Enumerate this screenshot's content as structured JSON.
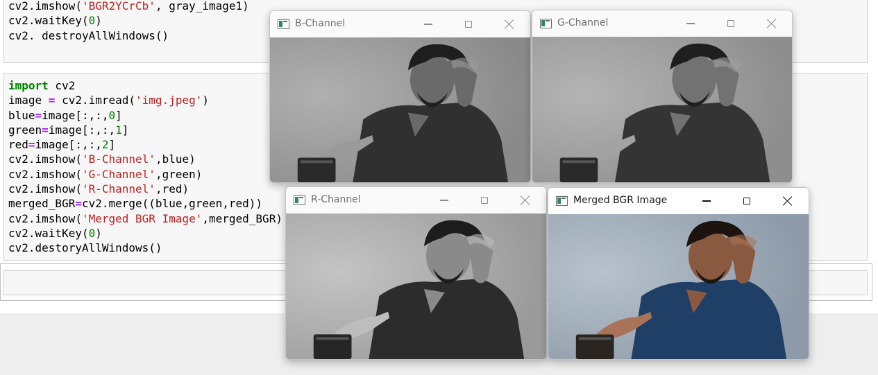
{
  "notebook": {
    "top_cell_lines": [
      {
        "parts": [
          {
            "t": "cv2.imshow(",
            "c": ""
          },
          {
            "t": "'BGR2YCrCb'",
            "c": "str"
          },
          {
            "t": ", gray_image1)",
            "c": ""
          }
        ]
      },
      {
        "parts": [
          {
            "t": "cv2.waitKey(",
            "c": ""
          },
          {
            "t": "0",
            "c": "num"
          },
          {
            "t": ")",
            "c": ""
          }
        ]
      },
      {
        "parts": [
          {
            "t": "cv2. destroyAllWindows()",
            "c": ""
          }
        ]
      }
    ],
    "main_cell_lines": [
      {
        "parts": [
          {
            "t": "import",
            "c": "kw"
          },
          {
            "t": " cv2",
            "c": ""
          }
        ]
      },
      {
        "parts": [
          {
            "t": "image ",
            "c": ""
          },
          {
            "t": "=",
            "c": "op"
          },
          {
            "t": " cv2.imread(",
            "c": ""
          },
          {
            "t": "'img.jpeg'",
            "c": "str"
          },
          {
            "t": ")",
            "c": ""
          }
        ]
      },
      {
        "parts": [
          {
            "t": "blue",
            "c": ""
          },
          {
            "t": "=",
            "c": "op"
          },
          {
            "t": "image[:,:,",
            "c": ""
          },
          {
            "t": "0",
            "c": "num"
          },
          {
            "t": "]",
            "c": ""
          }
        ]
      },
      {
        "parts": [
          {
            "t": "green",
            "c": ""
          },
          {
            "t": "=",
            "c": "op"
          },
          {
            "t": "image[:,:,",
            "c": ""
          },
          {
            "t": "1",
            "c": "num"
          },
          {
            "t": "]",
            "c": ""
          }
        ]
      },
      {
        "parts": [
          {
            "t": "red",
            "c": ""
          },
          {
            "t": "=",
            "c": "op"
          },
          {
            "t": "image[:,:,",
            "c": ""
          },
          {
            "t": "2",
            "c": "num"
          },
          {
            "t": "]",
            "c": ""
          }
        ]
      },
      {
        "parts": [
          {
            "t": "cv2.imshow(",
            "c": ""
          },
          {
            "t": "'B-Channel'",
            "c": "str"
          },
          {
            "t": ",blue)",
            "c": ""
          }
        ]
      },
      {
        "parts": [
          {
            "t": "cv2.imshow(",
            "c": ""
          },
          {
            "t": "'G-Channel'",
            "c": "str"
          },
          {
            "t": ",green)",
            "c": ""
          }
        ]
      },
      {
        "parts": [
          {
            "t": "cv2.imshow(",
            "c": ""
          },
          {
            "t": "'R-Channel'",
            "c": "str"
          },
          {
            "t": ",red)",
            "c": ""
          }
        ]
      },
      {
        "parts": [
          {
            "t": "merged_BGR",
            "c": ""
          },
          {
            "t": "=",
            "c": "op"
          },
          {
            "t": "cv2.merge((blue,green,red))",
            "c": ""
          }
        ]
      },
      {
        "parts": [
          {
            "t": "cv2.imshow(",
            "c": ""
          },
          {
            "t": "'Merged BGR Image'",
            "c": "str"
          },
          {
            "t": ",merged_BGR)",
            "c": ""
          }
        ]
      },
      {
        "parts": [
          {
            "t": "cv2.waitKey(",
            "c": ""
          },
          {
            "t": "0",
            "c": "num"
          },
          {
            "t": ")",
            "c": ""
          }
        ]
      },
      {
        "parts": [
          {
            "t": "cv2.destoryAllWindows()",
            "c": ""
          }
        ]
      }
    ]
  },
  "windows": {
    "b_channel": {
      "title": "B-Channel"
    },
    "g_channel": {
      "title": "G-Channel"
    },
    "r_channel": {
      "title": "R-Channel"
    },
    "merged": {
      "title": "Merged BGR Image"
    }
  },
  "icons": {
    "app": "opencv-window-icon",
    "minimize": "minimize-icon",
    "maximize": "maximize-icon",
    "close": "close-icon"
  },
  "colors": {
    "keyword": "#008000",
    "operator": "#aa22ff",
    "string": "#ba2121",
    "number": "#008000"
  }
}
